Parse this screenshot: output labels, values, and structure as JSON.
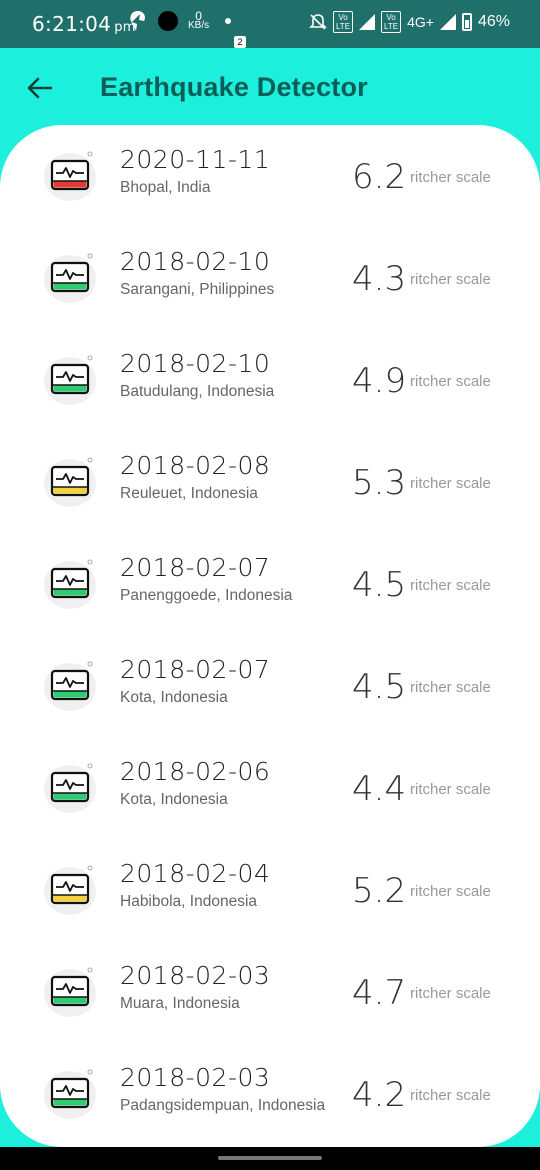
{
  "status": {
    "time": "6:21:04",
    "ampm": "pm",
    "speed_value": "0",
    "speed_unit": "KB/s",
    "notif_badge": "2",
    "network": "4G+",
    "battery": "46%"
  },
  "appbar": {
    "title": "Earthquake Detector"
  },
  "earthquakes": [
    {
      "date": "2020-11-11",
      "place": "Bhopal, India",
      "magnitude": "6.2",
      "unit": "ritcher scale",
      "level_color": "#e53935"
    },
    {
      "date": "2018-02-10",
      "place": "Sarangani, Philippines",
      "magnitude": "4.3",
      "unit": "ritcher scale",
      "level_color": "#2ecc71"
    },
    {
      "date": "2018-02-10",
      "place": "Batudulang, Indonesia",
      "magnitude": "4.9",
      "unit": "ritcher scale",
      "level_color": "#2ecc71"
    },
    {
      "date": "2018-02-08",
      "place": "Reuleuet, Indonesia",
      "magnitude": "5.3",
      "unit": "ritcher scale",
      "level_color": "#f4d03f"
    },
    {
      "date": "2018-02-07",
      "place": "Panenggoede, Indonesia",
      "magnitude": "4.5",
      "unit": "ritcher scale",
      "level_color": "#2ecc71"
    },
    {
      "date": "2018-02-07",
      "place": "Kota, Indonesia",
      "magnitude": "4.5",
      "unit": "ritcher scale",
      "level_color": "#2ecc71"
    },
    {
      "date": "2018-02-06",
      "place": "Kota, Indonesia",
      "magnitude": "4.4",
      "unit": "ritcher scale",
      "level_color": "#2ecc71"
    },
    {
      "date": "2018-02-04",
      "place": "Habibola, Indonesia",
      "magnitude": "5.2",
      "unit": "ritcher scale",
      "level_color": "#f4d03f"
    },
    {
      "date": "2018-02-03",
      "place": "Muara, Indonesia",
      "magnitude": "4.7",
      "unit": "ritcher scale",
      "level_color": "#2ecc71"
    },
    {
      "date": "2018-02-03",
      "place": "Padangsidempuan, Indonesia",
      "magnitude": "4.2",
      "unit": "ritcher scale",
      "level_color": "#2ecc71"
    }
  ]
}
